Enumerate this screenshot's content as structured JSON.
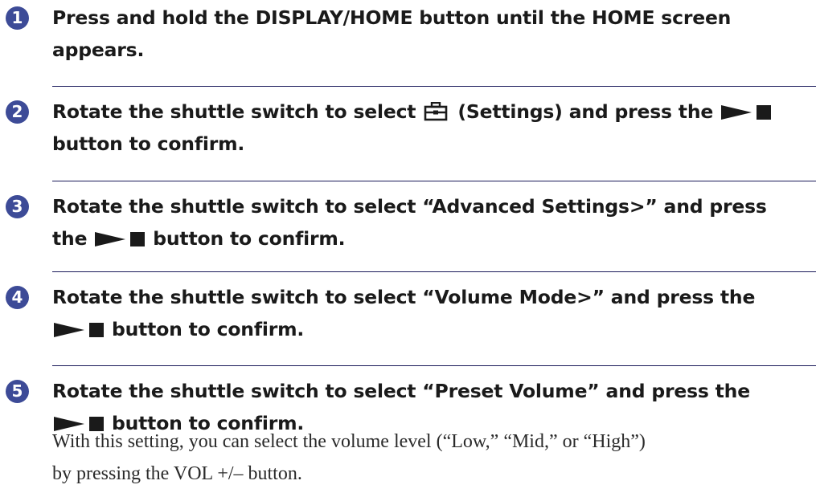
{
  "steps": [
    {
      "number": "1",
      "lines": [
        "Press and hold the DISPLAY/HOME button until the HOME screen",
        "appears."
      ]
    },
    {
      "number": "2",
      "text_a": "Rotate the shuttle switch to select",
      "text_b": "(Settings) and press the",
      "text_c": "button to confirm.",
      "icon": "settings-toolbox-icon"
    },
    {
      "number": "3",
      "text_a": "Rotate the shuttle switch to select “Advanced Settings>” and press",
      "text_b": "the",
      "text_c": "button to confirm."
    },
    {
      "number": "4",
      "text_a": "Rotate the shuttle switch to select “Volume Mode>” and press the",
      "text_c": "button to confirm."
    },
    {
      "number": "5",
      "text_a": "Rotate the shuttle switch to select “Preset Volume” and press the",
      "text_c": "button to confirm.",
      "note_lines": [
        "With this setting, you can select the volume level (“Low,” “Mid,” or “High”)",
        "by pressing the VOL +/– button."
      ]
    }
  ],
  "icons": {
    "play_stop": "play-stop-icon",
    "settings": "settings-toolbox-icon"
  },
  "colors": {
    "number_circle": "#3d4b97",
    "rule": "#1a1a5a",
    "text": "#1a1a1a"
  }
}
